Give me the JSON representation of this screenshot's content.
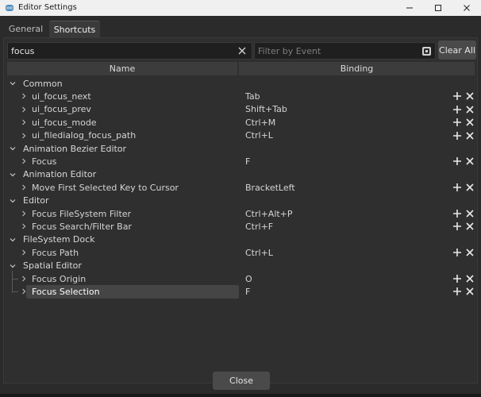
{
  "window": {
    "title": "Editor Settings",
    "icon": "godot-icon"
  },
  "tabs": [
    {
      "label": "General",
      "active": false
    },
    {
      "label": "Shortcuts",
      "active": true
    }
  ],
  "search": {
    "value": "focus",
    "placeholder": ""
  },
  "event_filter": {
    "value": "",
    "placeholder": "Filter by Event"
  },
  "clear_all_label": "Clear All",
  "columns": {
    "name": "Name",
    "binding": "Binding"
  },
  "tree": [
    {
      "category": "Common",
      "items": [
        {
          "name": "ui_focus_next",
          "binding": "Tab"
        },
        {
          "name": "ui_focus_prev",
          "binding": "Shift+Tab"
        },
        {
          "name": "ui_focus_mode",
          "binding": "Ctrl+M"
        },
        {
          "name": "ui_filedialog_focus_path",
          "binding": "Ctrl+L"
        }
      ]
    },
    {
      "category": "Animation Bezier Editor",
      "items": [
        {
          "name": "Focus",
          "binding": "F"
        }
      ]
    },
    {
      "category": "Animation Editor",
      "items": [
        {
          "name": "Move First Selected Key to Cursor",
          "binding": "BracketLeft"
        }
      ]
    },
    {
      "category": "Editor",
      "items": [
        {
          "name": "Focus FileSystem Filter",
          "binding": "Ctrl+Alt+P"
        },
        {
          "name": "Focus Search/Filter Bar",
          "binding": "Ctrl+F"
        }
      ]
    },
    {
      "category": "FileSystem Dock",
      "items": [
        {
          "name": "Focus Path",
          "binding": "Ctrl+L"
        }
      ]
    },
    {
      "category": "Spatial Editor",
      "items": [
        {
          "name": "Focus Origin",
          "binding": "O"
        },
        {
          "name": "Focus Selection",
          "binding": "F",
          "selected": true
        }
      ]
    }
  ],
  "close_label": "Close",
  "colors": {
    "background": "#2b2b2b",
    "panel": "#2f2f2f",
    "header": "#3c3c3c",
    "selection": "#454545",
    "button": "#4a4a4a"
  }
}
